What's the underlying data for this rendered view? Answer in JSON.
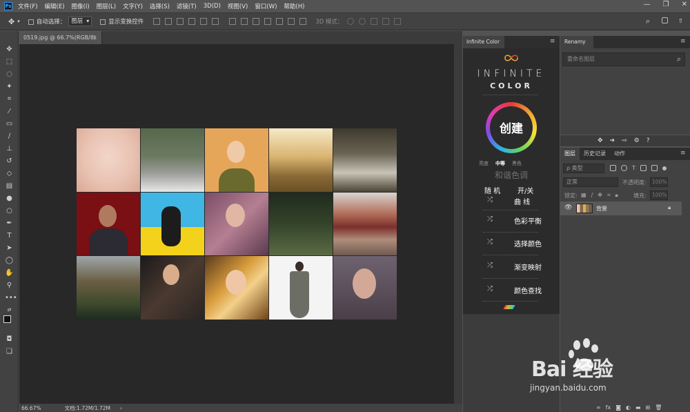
{
  "app": {
    "name": "Photoshop",
    "logo": "Ps"
  },
  "menubar": {
    "items": [
      "文件(F)",
      "编辑(E)",
      "图像(I)",
      "图层(L)",
      "文字(Y)",
      "选择(S)",
      "滤镜(T)",
      "3D(D)",
      "视图(V)",
      "窗口(W)",
      "帮助(H)"
    ]
  },
  "window_controls": [
    "—",
    "❐",
    "✕"
  ],
  "options_bar": {
    "auto_select_label": "自动选择：",
    "auto_select_value": "图层",
    "show_transform_label": "显示变换控件",
    "mode_3d_label": "3D 模式："
  },
  "document": {
    "tab_title": "0519.jpg @ 66.7%(RGB/8)",
    "zoom": "66.67%",
    "doc_info": "文档:1.72M/1.72M"
  },
  "infinite_color": {
    "panel_tab": "Infinite Color",
    "title_line1": "INFINITE",
    "title_line2": "COLOR",
    "create_button": "创建",
    "levels": [
      "亮度",
      "中等",
      "黑色"
    ],
    "harmony_label": "和谐色调",
    "random_label": "随 机",
    "toggle_label": "开/关",
    "adjustments": [
      "曲 线",
      "色彩平衡",
      "选择颜色",
      "渐变映射",
      "颜色查找"
    ]
  },
  "renamy": {
    "panel_tab": "Renamy",
    "input_placeholder": "重命名图层"
  },
  "layers": {
    "tabs": [
      "图层",
      "历史记录",
      "动作"
    ],
    "filter_placeholder": "ρ 类型",
    "blend_mode": "正常",
    "opacity_label": "不透明度:",
    "opacity_value": "100%",
    "lock_label": "锁定:",
    "fill_label": "填充:",
    "fill_value": "100%",
    "layer_name": "背景"
  },
  "watermark": {
    "brand_text": "Bai  经验",
    "url": "jingyan.baidu.com"
  },
  "colors": {
    "menubar_bg": "#535353",
    "panel_bg": "#424242",
    "canvas_bg": "#282828",
    "accent": "#31a8ff"
  }
}
